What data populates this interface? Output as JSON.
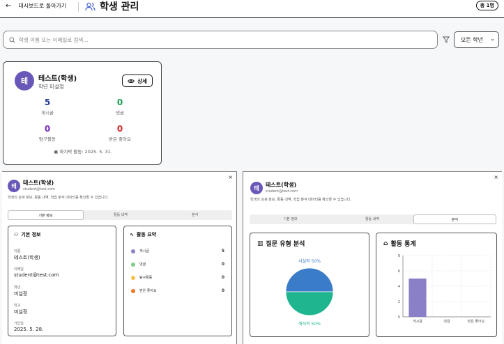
{
  "header": {
    "back_label": "대시보드로 돌아가기",
    "title": "학생 관리",
    "count_badge": "총 1명"
  },
  "search": {
    "placeholder": "학생 이름 또는 이메일로 검색...",
    "value": ""
  },
  "filter": {
    "grade_selected": "모든 학년"
  },
  "student_card": {
    "avatar": "테",
    "name": "테스트(학생)",
    "grade": "학년 미설정",
    "detail_label": "상세",
    "stats": [
      {
        "value": "5",
        "label": "게시글",
        "color": "#1f3a93"
      },
      {
        "value": "0",
        "label": "댓글",
        "color": "#1a9e4a"
      },
      {
        "value": "0",
        "label": "탐구활동",
        "color": "#7b2cbf"
      },
      {
        "value": "0",
        "label": "받은 좋아요",
        "color": "#d62828"
      }
    ],
    "last_activity": "마지막 활동: 2025. 5. 31."
  },
  "detail_left": {
    "avatar": "테",
    "name": "테스트(학생)",
    "email": "student@test.com",
    "description": "학생의 상세 정보, 활동 내역, 학습 분석 데이터를 확인할 수 있습니다.",
    "tabs": [
      "기본 정보",
      "활동 내역",
      "분석"
    ],
    "active_tab": 0,
    "basic_info": {
      "title": "기본 정보",
      "fields": [
        {
          "label": "이름",
          "value": "테스트(학생)"
        },
        {
          "label": "이메일",
          "value": "student@test.com"
        },
        {
          "label": "학년",
          "value": "미설정"
        },
        {
          "label": "학교",
          "value": "미설정"
        },
        {
          "label": "가입일",
          "value": "2025. 5. 28."
        }
      ]
    },
    "activity_summary": {
      "title": "활동 요약",
      "rows": [
        {
          "label": "게시글",
          "value": "5",
          "color": "#8a80c8"
        },
        {
          "label": "댓글",
          "value": "0",
          "color": "#7fce8a"
        },
        {
          "label": "탐구활동",
          "value": "0",
          "color": "#f5c04a"
        },
        {
          "label": "받은 좋아요",
          "value": "0",
          "color": "#ef7a24"
        }
      ]
    }
  },
  "detail_right": {
    "avatar": "테",
    "name": "테스트(학생)",
    "email": "student@test.com",
    "description": "학생의 상세 정보, 활동 내역, 학습 분석 데이터를 확인할 수 있습니다.",
    "tabs": [
      "기본 정보",
      "활동 내역",
      "분석"
    ],
    "active_tab": 2,
    "pie_title": "질문 유형 분석",
    "bar_title": "활동 통계"
  },
  "chart_data": [
    {
      "type": "pie",
      "title": "질문 유형 분석",
      "labels": [
        "사실적",
        "해석적"
      ],
      "values": [
        50,
        50
      ],
      "label_texts": [
        "사실적 50%",
        "해석적 50%"
      ],
      "colors": [
        "#3a7cc7",
        "#1fb58f"
      ]
    },
    {
      "type": "bar",
      "title": "활동 통계",
      "categories": [
        "게시글",
        "댓글",
        "받은 좋아요"
      ],
      "values": [
        5,
        0,
        0
      ],
      "ylim": [
        0,
        8
      ],
      "yticks": [
        "0",
        "2",
        "4",
        "6",
        "8"
      ],
      "grid": true,
      "color": "#8a80c8"
    }
  ]
}
